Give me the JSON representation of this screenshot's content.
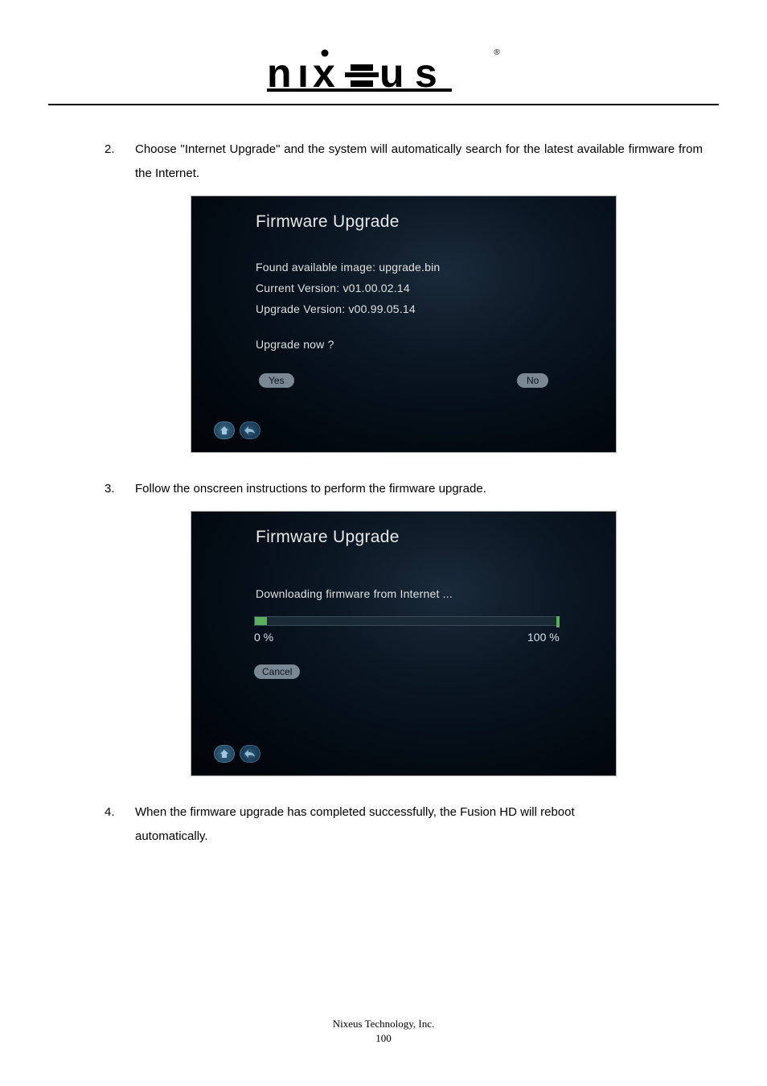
{
  "logo": {
    "registered": "®"
  },
  "steps": {
    "s2": {
      "num": "2.",
      "text": "Choose \"Internet Upgrade\" and the system will automatically search for the latest available firmware from the Internet."
    },
    "s3": {
      "num": "3.",
      "text": "Follow the onscreen instructions to perform the firmware upgrade."
    },
    "s4": {
      "num": "4.",
      "text_line1": "When the firmware upgrade has completed successfully, the Fusion HD will reboot",
      "text_line2": "automatically."
    }
  },
  "screenshot1": {
    "title": "Firmware Upgrade",
    "line1": "Found available image: upgrade.bin",
    "line2": "Current Version: v01.00.02.14",
    "line3": "Upgrade Version: v00.99.05.14",
    "line4": "Upgrade now ?",
    "yes": "Yes",
    "no": "No"
  },
  "screenshot2": {
    "title": "Firmware Upgrade",
    "line1": "Downloading firmware from Internet ...",
    "pct0": "0 %",
    "pct100": "100 %",
    "cancel": "Cancel"
  },
  "footer": {
    "company": "Nixeus Technology, Inc.",
    "page": "100"
  }
}
